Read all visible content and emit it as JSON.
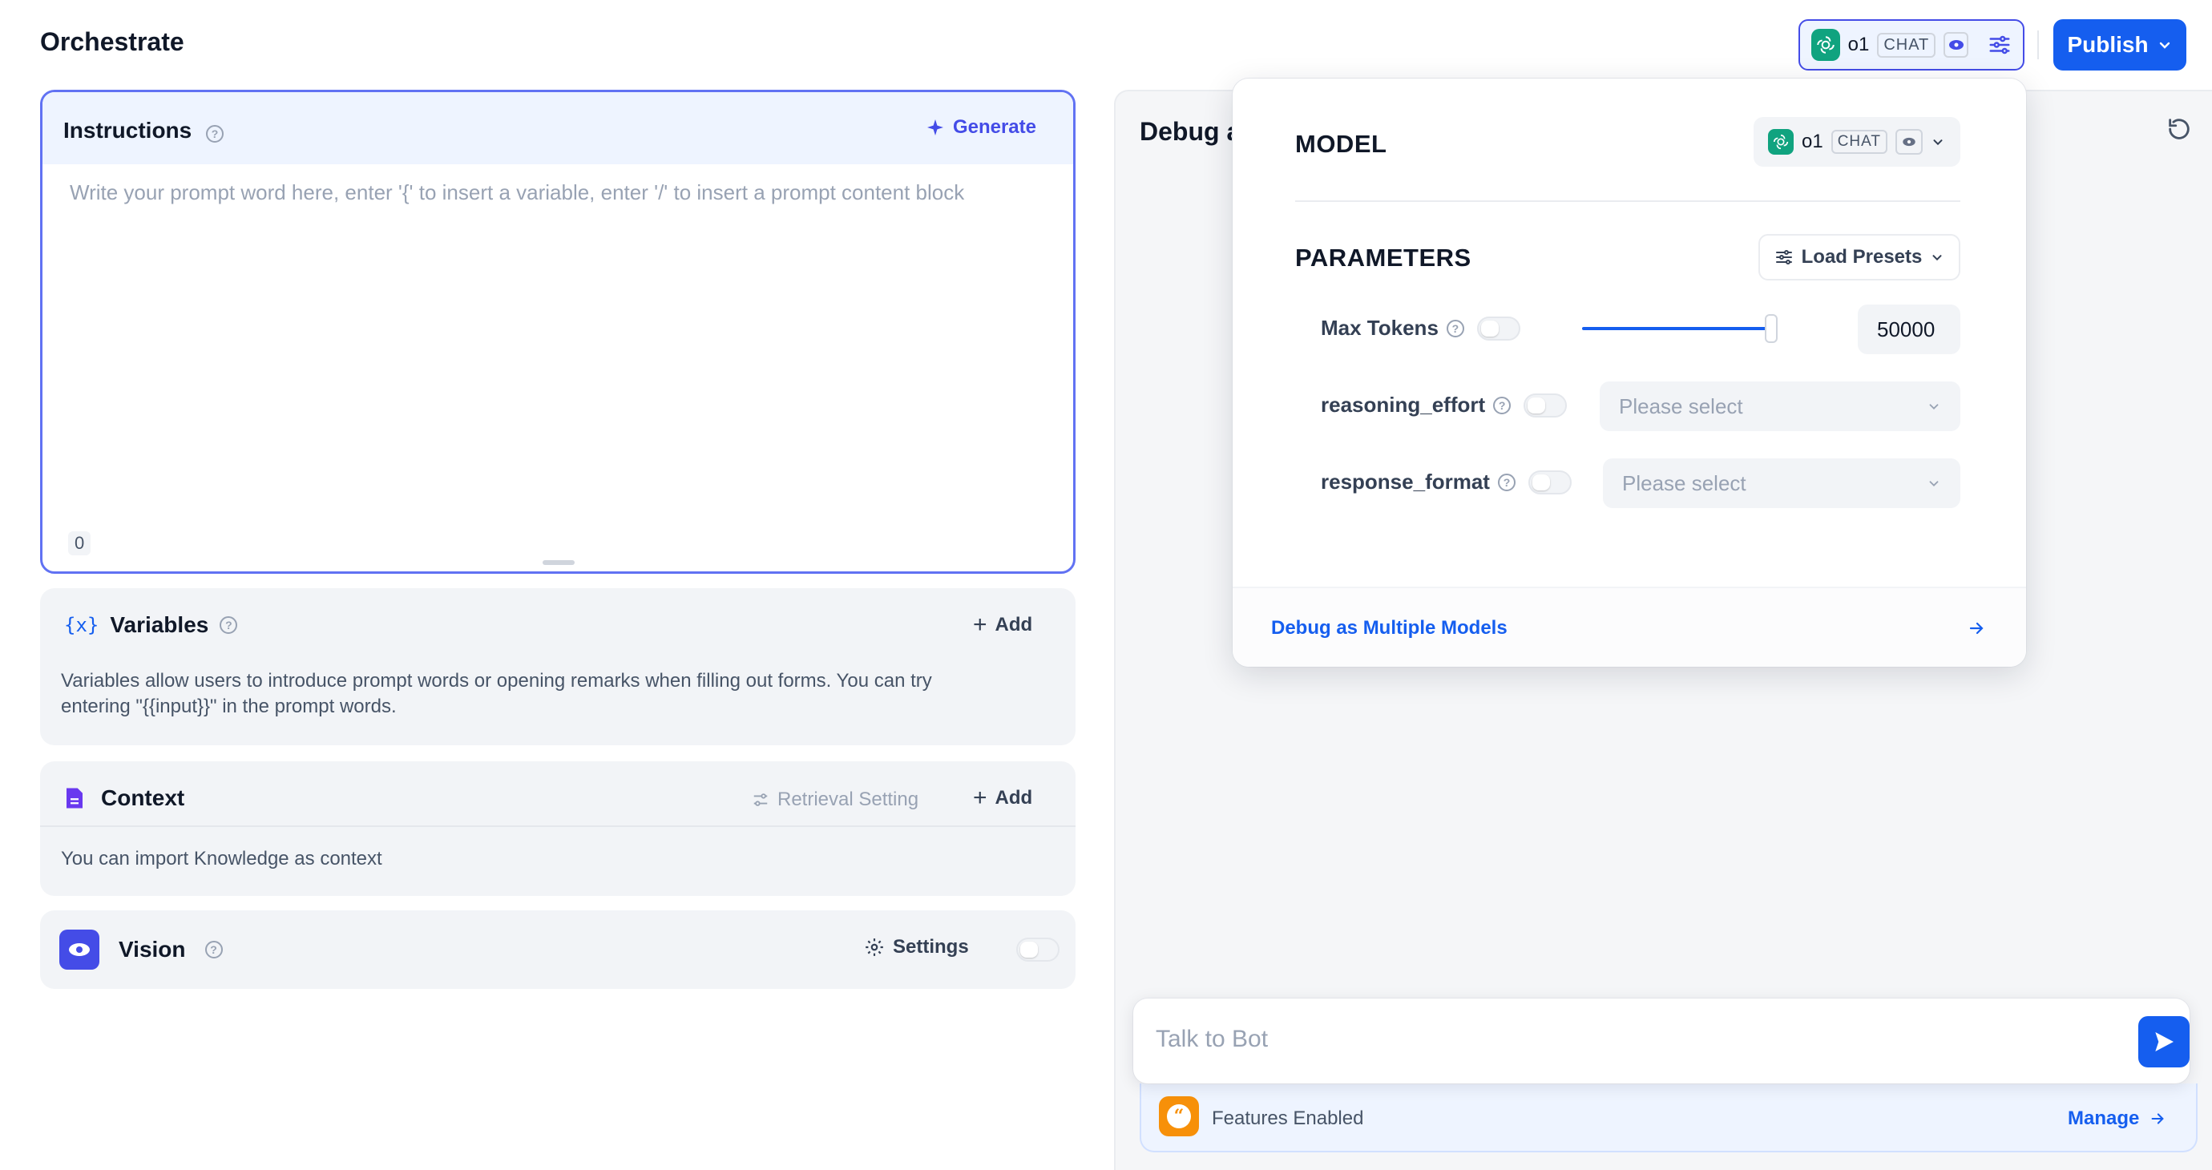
{
  "header": {
    "title": "Orchestrate",
    "model_name": "o1",
    "model_tag": "CHAT",
    "publish_label": "Publish"
  },
  "instructions": {
    "title": "Instructions",
    "generate_label": "Generate",
    "placeholder": "Write your prompt word here, enter '{' to insert a variable, enter '/' to insert a prompt content block",
    "char_count": "0"
  },
  "variables": {
    "title": "Variables",
    "add_label": "Add",
    "description_line1": "Variables allow users to introduce prompt words or opening remarks when filling out forms. You can try",
    "description_line2": "entering \"{{input}}\" in the prompt words."
  },
  "context": {
    "title": "Context",
    "retrieval_label": "Retrieval Setting",
    "add_label": "Add",
    "description": "You can import Knowledge as context"
  },
  "vision": {
    "title": "Vision",
    "settings_label": "Settings",
    "enabled": false
  },
  "debug": {
    "title_visible": "Debug a"
  },
  "model_popup": {
    "model_heading": "MODEL",
    "model_name": "o1",
    "model_tag": "CHAT",
    "parameters_heading": "PARAMETERS",
    "load_presets_label": "Load Presets",
    "params": [
      {
        "label": "Max Tokens",
        "value": "50000",
        "enabled": false,
        "slider_fraction": 0.98
      },
      {
        "label": "reasoning_effort",
        "placeholder": "Please select",
        "enabled": false
      },
      {
        "label": "response_format",
        "placeholder": "Please select",
        "enabled": false
      }
    ],
    "footer_link": "Debug as Multiple Models"
  },
  "chat": {
    "placeholder": "Talk to Bot"
  },
  "features": {
    "label": "Features Enabled",
    "manage_label": "Manage"
  },
  "colors": {
    "primary": "#155eef",
    "accent": "#444ce7",
    "openai_green": "#10a37f",
    "features_orange": "#f79009"
  }
}
